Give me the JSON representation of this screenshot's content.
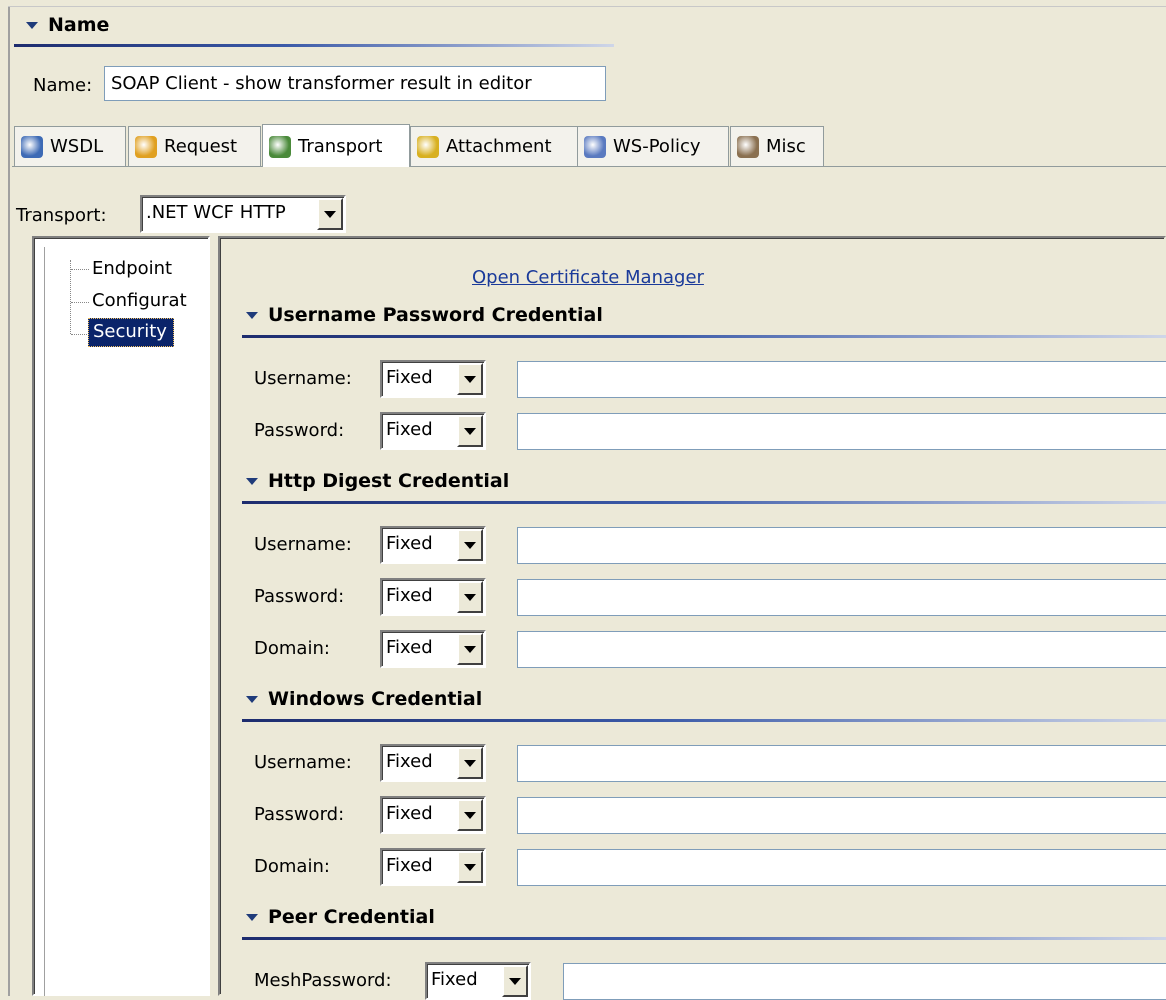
{
  "name_section": {
    "title": "Name",
    "name_label": "Name:",
    "name_value": "SOAP Client - show transformer result in editor"
  },
  "tabs": [
    {
      "label": "WSDL",
      "icon": "wsdl-icon"
    },
    {
      "label": "Request",
      "icon": "request-icon"
    },
    {
      "label": "Transport",
      "icon": "transport-icon"
    },
    {
      "label": "Attachment",
      "icon": "attachment-icon"
    },
    {
      "label": "WS-Policy",
      "icon": "ws-policy-icon"
    },
    {
      "label": "Misc",
      "icon": "misc-icon"
    }
  ],
  "active_tab": "Transport",
  "transport": {
    "label": "Transport:",
    "value": ".NET WCF HTTP"
  },
  "tree": {
    "items": [
      "Endpoint",
      "Configurat",
      "Security"
    ],
    "selected": "Security"
  },
  "cert_link": "Open Certificate Manager",
  "sections": [
    {
      "title": "Username Password Credential",
      "rows": [
        {
          "label": "Username:",
          "mode": "Fixed",
          "value": ""
        },
        {
          "label": "Password:",
          "mode": "Fixed",
          "value": ""
        }
      ]
    },
    {
      "title": "Http Digest Credential",
      "rows": [
        {
          "label": "Username:",
          "mode": "Fixed",
          "value": ""
        },
        {
          "label": "Password:",
          "mode": "Fixed",
          "value": ""
        },
        {
          "label": "Domain:",
          "mode": "Fixed",
          "value": ""
        }
      ]
    },
    {
      "title": "Windows Credential",
      "rows": [
        {
          "label": "Username:",
          "mode": "Fixed",
          "value": ""
        },
        {
          "label": "Password:",
          "mode": "Fixed",
          "value": ""
        },
        {
          "label": "Domain:",
          "mode": "Fixed",
          "value": ""
        }
      ]
    },
    {
      "title": "Peer Credential",
      "rows": [
        {
          "label": "MeshPassword:",
          "mode": "Fixed",
          "value": ""
        }
      ]
    }
  ]
}
